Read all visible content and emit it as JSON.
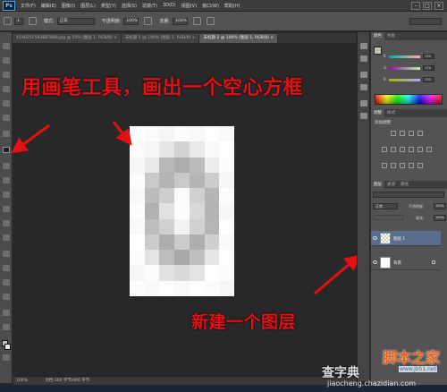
{
  "menubar": {
    "logo": "Ps",
    "items": [
      "文件(F)",
      "编辑(E)",
      "图像(I)",
      "图层(L)",
      "类型(Y)",
      "选择(S)",
      "滤镜(T)",
      "3D(D)",
      "视图(V)",
      "窗口(W)",
      "帮助(H)"
    ],
    "window_controls": [
      "–",
      "□",
      "×"
    ]
  },
  "options": {
    "brush_size": "1",
    "mode_label": "模式:",
    "mode_value": "正常",
    "opacity_label": "不透明度:",
    "opacity_value": "100%",
    "flow_label": "流量:",
    "flow_value": "100%"
  },
  "tabs": [
    {
      "label": "A14B25C5836B7898.jpg @ 50% (图层 1, RGB/8) ×",
      "active": false
    },
    {
      "label": "未标题-1 @ 100% (图层 1, RGB/8) ×",
      "active": false
    },
    {
      "label": "未标题-2 @ 100% (图层 1, RGB/8) ×",
      "active": true
    }
  ],
  "instructions": {
    "top": "用画笔工具，画出一个空心方框",
    "bottom": "新建一个图层"
  },
  "status": {
    "zoom": "100%",
    "doc_info": "文档:300 字节/400 字节"
  },
  "color_panel": {
    "tabs": [
      "颜色",
      "色板"
    ],
    "channels": [
      {
        "label": "R",
        "value": "170"
      },
      {
        "label": "G",
        "value": "174"
      },
      {
        "label": "B",
        "value": "170"
      }
    ]
  },
  "adjust_panel": {
    "tabs": [
      "调整",
      "样式"
    ],
    "title": "添加调整"
  },
  "layers_panel": {
    "tabs": [
      "图层",
      "通道",
      "路径"
    ],
    "blend_mode": "正常",
    "opacity_label": "不透明度:",
    "opacity_value": "100%",
    "fill_label": "填充:",
    "fill_value": "100%",
    "layers": [
      {
        "name": "图层 1",
        "selected": true
      },
      {
        "name": "背景",
        "selected": false
      }
    ]
  },
  "watermark": {
    "brand_a": "查字典",
    "brand_b": "脚本之家",
    "url_a": "jiaocheng.chazidian.com",
    "url_b": "www.jb51.net"
  },
  "colors": {
    "annotation_red": "#e50f14",
    "foreground": "#b8c8b0",
    "layer_selected": "#5a6d8c"
  }
}
